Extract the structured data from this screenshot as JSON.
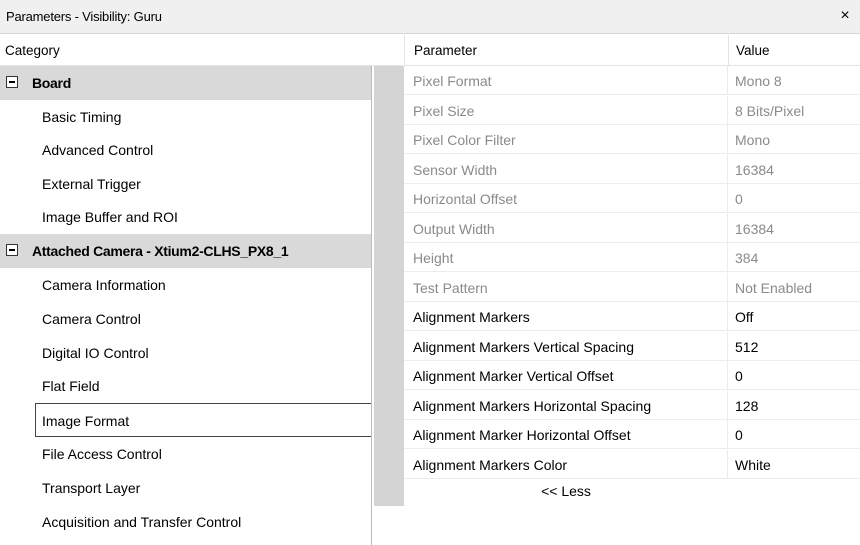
{
  "window": {
    "title": "Parameters - Visibility: Guru",
    "close_glyph": "×"
  },
  "headers": {
    "category": "Category",
    "parameter": "Parameter",
    "value": "Value"
  },
  "tree": {
    "items": [
      {
        "label": "Board",
        "type": "group"
      },
      {
        "label": "Basic Timing",
        "type": "child"
      },
      {
        "label": "Advanced Control",
        "type": "child"
      },
      {
        "label": "External Trigger",
        "type": "child"
      },
      {
        "label": "Image Buffer and ROI",
        "type": "child"
      },
      {
        "label": "Attached Camera - Xtium2-CLHS_PX8_1",
        "type": "group"
      },
      {
        "label": "Camera Information",
        "type": "child"
      },
      {
        "label": "Camera Control",
        "type": "child"
      },
      {
        "label": "Digital IO Control",
        "type": "child"
      },
      {
        "label": "Flat Field",
        "type": "child"
      },
      {
        "label": "Image Format",
        "type": "child",
        "selected": true
      },
      {
        "label": "File Access Control",
        "type": "child"
      },
      {
        "label": "Transport Layer",
        "type": "child"
      },
      {
        "label": "Acquisition and Transfer Control",
        "type": "child"
      }
    ]
  },
  "parameters": [
    {
      "name": "Pixel Format",
      "value": "Mono 8",
      "readonly": true
    },
    {
      "name": "Pixel Size",
      "value": "8 Bits/Pixel",
      "readonly": true
    },
    {
      "name": "Pixel Color Filter",
      "value": "Mono",
      "readonly": true
    },
    {
      "name": "Sensor Width",
      "value": "16384",
      "readonly": true
    },
    {
      "name": "Horizontal Offset",
      "value": "0",
      "readonly": true
    },
    {
      "name": "Output Width",
      "value": "16384",
      "readonly": true
    },
    {
      "name": "Height",
      "value": "384",
      "readonly": true
    },
    {
      "name": "Test Pattern",
      "value": "Not Enabled",
      "readonly": true
    },
    {
      "name": "Alignment Markers",
      "value": "Off",
      "readonly": false
    },
    {
      "name": "Alignment Markers Vertical Spacing",
      "value": "512",
      "readonly": false
    },
    {
      "name": "Alignment Marker Vertical Offset",
      "value": "0",
      "readonly": false
    },
    {
      "name": "Alignment Markers Horizontal Spacing",
      "value": "128",
      "readonly": false
    },
    {
      "name": "Alignment Marker Horizontal Offset",
      "value": "0",
      "readonly": false
    },
    {
      "name": "Alignment Markers Color",
      "value": "White",
      "readonly": false
    }
  ],
  "footer": {
    "less_label": "<< Less"
  }
}
